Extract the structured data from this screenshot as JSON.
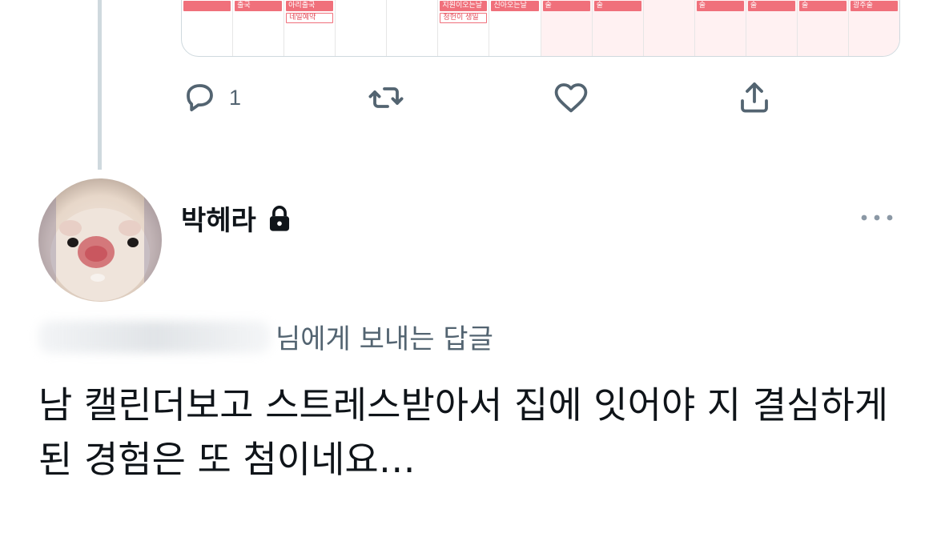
{
  "calendar_preview": {
    "cells": [
      {
        "tags": [
          ""
        ],
        "pink": false
      },
      {
        "tags": [
          "출국"
        ],
        "pink": false
      },
      {
        "tags": [
          "아리출국",
          "네일예약"
        ],
        "pink": false
      },
      {
        "tags": [],
        "pink": false
      },
      {
        "tags": [],
        "pink": false
      },
      {
        "tags": [
          "지원이오는날",
          "청헌이 생일"
        ],
        "pink": false
      },
      {
        "tags": [
          "신아오는날"
        ],
        "pink": false
      },
      {
        "tags": [
          "술"
        ],
        "pink": true
      },
      {
        "tags": [
          "술"
        ],
        "pink": true
      },
      {
        "tags": [],
        "pink": true
      },
      {
        "tags": [
          "술"
        ],
        "pink": true
      },
      {
        "tags": [
          "술"
        ],
        "pink": true
      },
      {
        "tags": [
          "술"
        ],
        "pink": true
      },
      {
        "tags": [
          "광주술"
        ],
        "pink": true
      }
    ],
    "accent_color": "#f0707b"
  },
  "actions": {
    "reply": {
      "icon": "reply-icon",
      "count": "1"
    },
    "retweet": {
      "icon": "retweet-icon"
    },
    "like": {
      "icon": "heart-icon"
    },
    "share": {
      "icon": "share-icon"
    }
  },
  "reply": {
    "author_name": "박헤라",
    "protected_icon": "lock-icon",
    "more_icon": "more-icon",
    "replying_to_suffix": "님에게 보내는 답글",
    "text": "남 캘린더보고 스트레스받아서 집에 잇어야 지 결심하게 된 경험은 또 첨이네요…"
  },
  "colors": {
    "text_primary": "#0f1419",
    "text_secondary": "#536471",
    "thread_line": "#cfd9de"
  }
}
